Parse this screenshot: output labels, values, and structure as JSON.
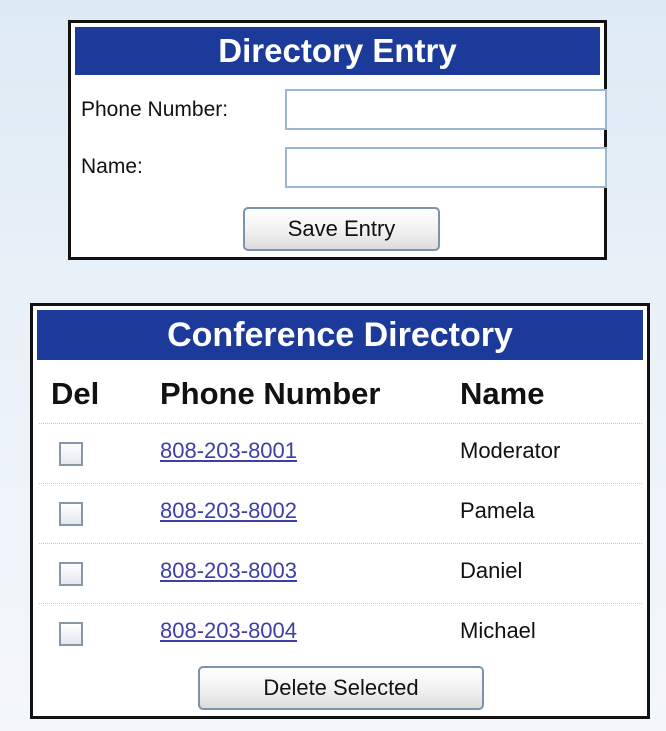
{
  "entry_form": {
    "title": "Directory Entry",
    "phone_label": "Phone Number:",
    "phone_value": "",
    "name_label": "Name:",
    "name_value": "",
    "save_label": "Save Entry"
  },
  "directory": {
    "title": "Conference Directory",
    "columns": {
      "del": "Del",
      "phone": "Phone Number",
      "name": "Name"
    },
    "rows": [
      {
        "phone": "808-203-8001",
        "name": "Moderator",
        "checked": false
      },
      {
        "phone": "808-203-8002",
        "name": "Pamela",
        "checked": false
      },
      {
        "phone": "808-203-8003",
        "name": "Daniel",
        "checked": false
      },
      {
        "phone": "808-203-8004",
        "name": "Michael",
        "checked": false
      }
    ],
    "delete_label": "Delete Selected"
  },
  "colors": {
    "header_bg": "#1c3a99",
    "link": "#3d3fa6",
    "field_border": "#9db6d2"
  }
}
